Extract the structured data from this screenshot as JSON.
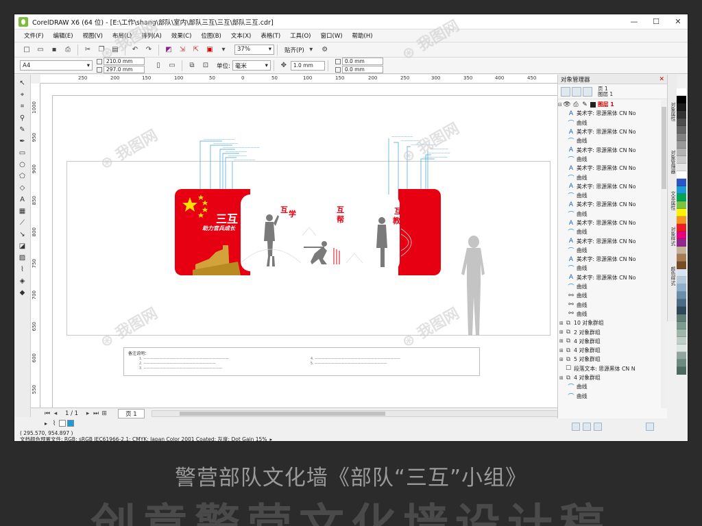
{
  "window": {
    "title": "CorelDRAW X6 (64 位) - [E:\\工作\\shang\\部队\\室内\\部队三互\\三互\\部队三互.cdr]",
    "minimize": "—",
    "maximize": "☐",
    "close": "✕"
  },
  "menu": {
    "items": [
      "文件(F)",
      "编辑(E)",
      "视图(V)",
      "布局(L)",
      "排列(A)",
      "效果(C)",
      "位图(B)",
      "文本(X)",
      "表格(T)",
      "工具(O)",
      "窗口(W)",
      "帮助(H)"
    ]
  },
  "toolbar1": {
    "zoom": "37%",
    "snap": "贴齐(P)"
  },
  "toolbar2": {
    "paper_size": "A4",
    "width": "210.0 mm",
    "height": "297.0 mm",
    "unit_label": "单位:",
    "unit": "毫米",
    "nudge": "1.0 mm",
    "dup_x": "0.0 mm",
    "dup_y": "0.0 mm"
  },
  "ruler": {
    "top": [
      "250",
      "200",
      "150",
      "100",
      "50",
      "0",
      "50",
      "100",
      "150",
      "200",
      "250",
      "300",
      "350",
      "400",
      "450"
    ],
    "left": [
      "1000",
      "950",
      "900",
      "850",
      "800",
      "750",
      "700",
      "650",
      "600",
      "550",
      "500"
    ]
  },
  "design": {
    "title": "三互",
    "subtitle": "助力官兵成长",
    "label_learn_a": "互",
    "label_learn_b": "学",
    "label_help_a": "互",
    "label_help_b": "帮",
    "label_teach_a": "互",
    "label_teach_b": "教",
    "callouts_left": [
      "——————————",
      "————————",
      "————————————",
      "———————",
      "——————",
      "———————"
    ],
    "callouts_right": [
      "———————",
      "——————",
      "————————",
      "——————",
      "———————",
      "————————"
    ]
  },
  "notes": {
    "title": "备注说明：",
    "col1": [
      "1. ——————————————————————————",
      "2. ——————————————————————",
      "3. ————————————————————————"
    ],
    "col2": [
      "4. ——————————————————————————",
      "5. ——————————————————————"
    ]
  },
  "pagebar": {
    "page_count": "1 / 1",
    "page_tab": "页 1"
  },
  "status": {
    "coords": "( 295.570, 954.897 )",
    "color_profile": "文档颜色预置文件: RGB: sRGB IEC61966-2.1; CMYK: Japan Color 2001 Coated; 灰度: Dot Gain 15%"
  },
  "object_manager": {
    "title": "对象管理器",
    "page_label": "页 1",
    "layer_label": "图层 1",
    "current_layer": "图层 1",
    "tree": [
      {
        "kind": "text",
        "label": "美术字: 思源黑体 CN No"
      },
      {
        "kind": "curve",
        "label": "曲线"
      },
      {
        "kind": "text",
        "label": "美术字: 思源黑体 CN No"
      },
      {
        "kind": "curve",
        "label": "曲线"
      },
      {
        "kind": "text",
        "label": "美术字: 思源黑体 CN No"
      },
      {
        "kind": "curve",
        "label": "曲线"
      },
      {
        "kind": "text",
        "label": "美术字: 思源黑体 CN No"
      },
      {
        "kind": "curve",
        "label": "曲线"
      },
      {
        "kind": "text",
        "label": "美术字: 思源黑体 CN No"
      },
      {
        "kind": "curve",
        "label": "曲线"
      },
      {
        "kind": "text",
        "label": "美术字: 思源黑体 CN No"
      },
      {
        "kind": "curve",
        "label": "曲线"
      },
      {
        "kind": "text",
        "label": "美术字: 思源黑体 CN No"
      },
      {
        "kind": "curve",
        "label": "曲线"
      },
      {
        "kind": "text",
        "label": "美术字: 思源黑体 CN No"
      },
      {
        "kind": "curve",
        "label": "曲线"
      },
      {
        "kind": "text",
        "label": "美术字: 思源黑体 CN No"
      },
      {
        "kind": "curve",
        "label": "曲线"
      },
      {
        "kind": "text",
        "label": "美术字: 思源黑体 CN No"
      },
      {
        "kind": "curve",
        "label": "曲线"
      },
      {
        "kind": "link",
        "label": "曲线"
      },
      {
        "kind": "link",
        "label": "曲线"
      },
      {
        "kind": "link",
        "label": "曲线"
      },
      {
        "kind": "group",
        "label": "10 对象群组"
      },
      {
        "kind": "group",
        "label": "2 对象群组"
      },
      {
        "kind": "group",
        "label": "4 对象群组"
      },
      {
        "kind": "group",
        "label": "4 对象群组"
      },
      {
        "kind": "group",
        "label": "5 对象群组"
      },
      {
        "kind": "para",
        "label": "段落文本: 思源黑体 CN N"
      },
      {
        "kind": "group",
        "label": "4 对象群组"
      },
      {
        "kind": "curve",
        "label": "曲线"
      },
      {
        "kind": "curve",
        "label": "曲线"
      }
    ]
  },
  "docker_tabs": [
    "对象属性",
    "对象管理器",
    "文本属性",
    "对象样式",
    "颜色样式"
  ],
  "palette": [
    "#ffffff",
    "#000000",
    "#1a1a1a",
    "#333333",
    "#4d4d4d",
    "#666666",
    "#808080",
    "#999999",
    "#b3b3b3",
    "#cccccc",
    "#e6e6e6",
    "#ffffff",
    "#2a55c6",
    "#1b9bd7",
    "#00a650",
    "#7cc242",
    "#fff200",
    "#f7941d",
    "#ed1c24",
    "#e6007e",
    "#92278f",
    "#c7b299",
    "#a67c52",
    "#754c24",
    "#d7e3f0",
    "#b5c9de",
    "#90afcc",
    "#6b8ea8",
    "#4b6a84",
    "#2f4858",
    "#5e7f77",
    "#7c9a90",
    "#9db7ab",
    "#bfcfc7",
    "#dfe7e3",
    "#8fa69e",
    "#6e8a80",
    "#4e6b62"
  ],
  "captions": {
    "line1": "警营部队文化墙《部队“三互”小组》",
    "line2": "创意警营文化墙设计稿"
  },
  "colors": {
    "accent_red": "#e60012",
    "callout_blue": "#1a88c9",
    "layer_red": "#d40000"
  }
}
